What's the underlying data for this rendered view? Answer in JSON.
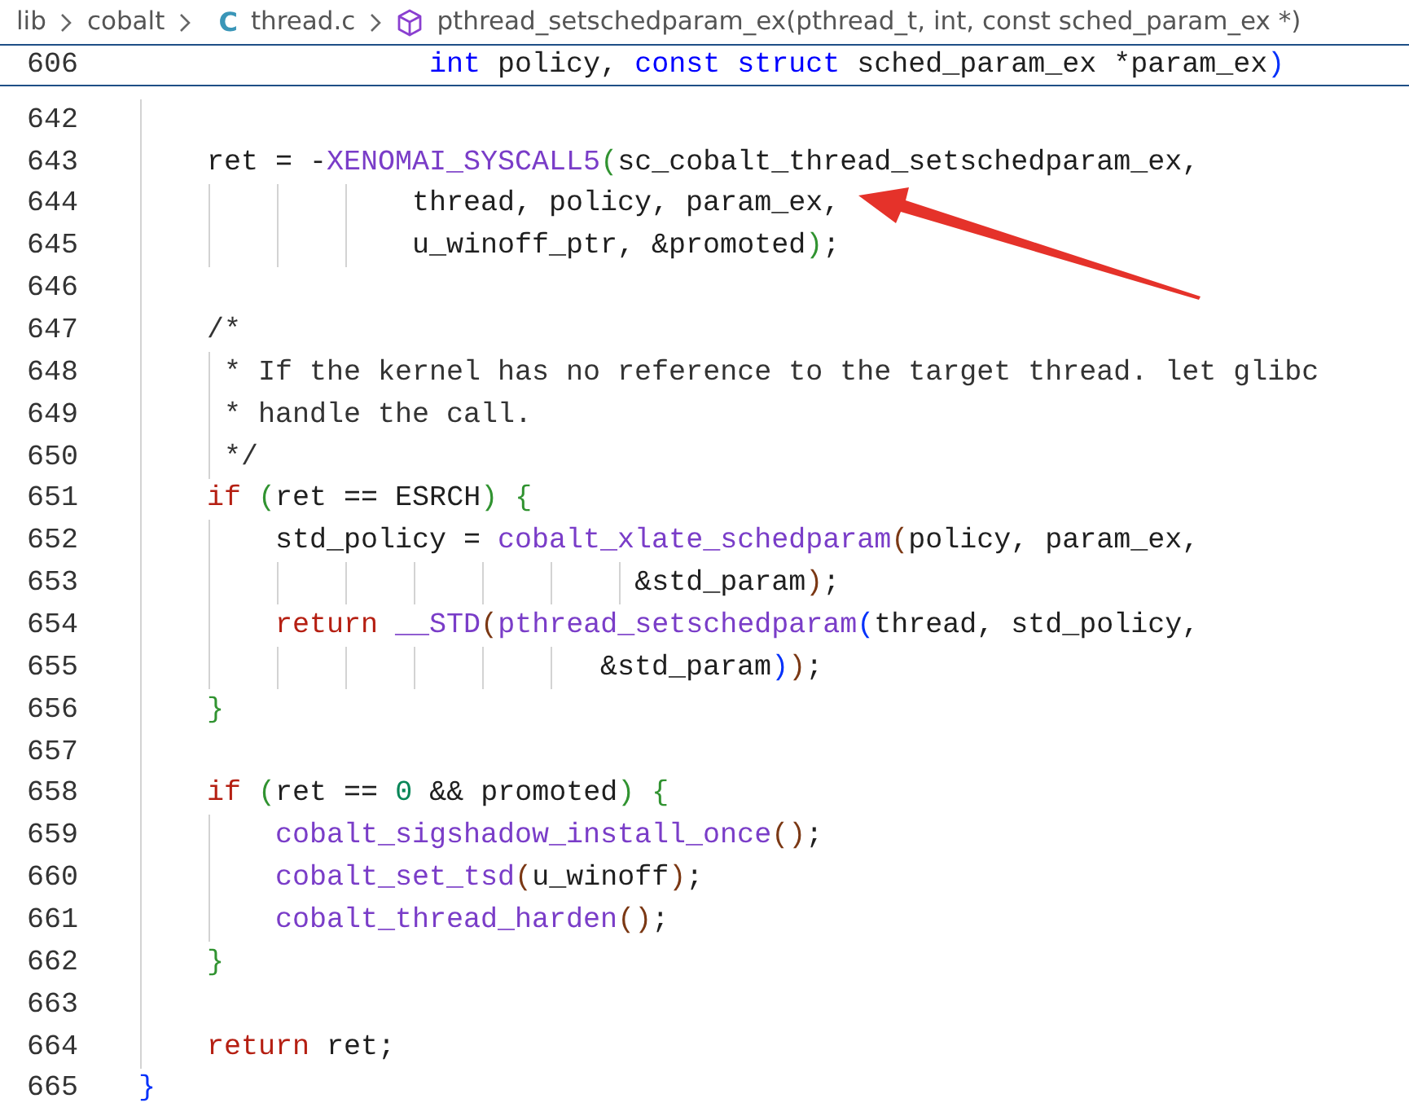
{
  "breadcrumb": [
    {
      "kind": "folder",
      "text": "lib"
    },
    {
      "kind": "folder",
      "text": "cobalt"
    },
    {
      "kind": "file",
      "icon": "C",
      "text": "thread.c"
    },
    {
      "kind": "symbol",
      "text": "pthread_setschedparam_ex(pthread_t, int, const sched_param_ex *)"
    }
  ],
  "sticky_line": {
    "number": "606",
    "tokens": [
      {
        "kind": "type",
        "text": "                 int"
      },
      {
        "kind": "txt",
        "text": " policy, "
      },
      {
        "kind": "type",
        "text": "const"
      },
      {
        "kind": "type",
        "text": " struct"
      },
      {
        "kind": "txt",
        "text": " sched_param_ex *param_ex"
      },
      {
        "kind": "br1",
        "text": ")"
      }
    ]
  },
  "lines": [
    {
      "number": "642"
    },
    {
      "number": "643",
      "tokens": [
        {
          "kind": "txt",
          "text": "    ret = -"
        },
        {
          "kind": "fn",
          "text": "XENOMAI_SYSCALL5"
        },
        {
          "kind": "br2",
          "text": "("
        },
        {
          "kind": "txt",
          "text": "sc_cobalt_thread_setschedparam_ex,"
        }
      ]
    },
    {
      "number": "644",
      "tokens": [
        {
          "kind": "txt",
          "text": "                thread, policy, param_ex,"
        }
      ]
    },
    {
      "number": "645",
      "tokens": [
        {
          "kind": "txt",
          "text": "                u_winoff_ptr, &promoted"
        },
        {
          "kind": "br2",
          "text": ")"
        },
        {
          "kind": "txt",
          "text": ";"
        }
      ]
    },
    {
      "number": "646"
    },
    {
      "number": "647",
      "tokens": [
        {
          "kind": "cmt",
          "text": "    /*"
        }
      ]
    },
    {
      "number": "648",
      "tokens": [
        {
          "kind": "cmt",
          "text": "     * If the kernel has no reference to the target thread. let glibc"
        }
      ]
    },
    {
      "number": "649",
      "tokens": [
        {
          "kind": "cmt",
          "text": "     * handle the call."
        }
      ]
    },
    {
      "number": "650",
      "tokens": [
        {
          "kind": "cmt",
          "text": "     */"
        }
      ]
    },
    {
      "number": "651",
      "tokens": [
        {
          "kind": "kw",
          "text": "    if"
        },
        {
          "kind": "br2",
          "text": " ("
        },
        {
          "kind": "txt",
          "text": "ret == ESRCH"
        },
        {
          "kind": "br2",
          "text": ")"
        },
        {
          "kind": "br2",
          "text": " {"
        }
      ]
    },
    {
      "number": "652",
      "tokens": [
        {
          "kind": "txt",
          "text": "        std_policy = "
        },
        {
          "kind": "fn",
          "text": "cobalt_xlate_schedparam"
        },
        {
          "kind": "br3",
          "text": "("
        },
        {
          "kind": "txt",
          "text": "policy, param_ex,"
        }
      ]
    },
    {
      "number": "653",
      "tokens": [
        {
          "kind": "txt",
          "text": "                             &std_param"
        },
        {
          "kind": "br3",
          "text": ")"
        },
        {
          "kind": "txt",
          "text": ";"
        }
      ]
    },
    {
      "number": "654",
      "tokens": [
        {
          "kind": "kw",
          "text": "        return"
        },
        {
          "kind": "fn",
          "text": " __STD"
        },
        {
          "kind": "br3",
          "text": "("
        },
        {
          "kind": "fn",
          "text": "pthread_setschedparam"
        },
        {
          "kind": "br1",
          "text": "("
        },
        {
          "kind": "txt",
          "text": "thread, std_policy,"
        }
      ]
    },
    {
      "number": "655",
      "tokens": [
        {
          "kind": "txt",
          "text": "                           &std_param"
        },
        {
          "kind": "br1",
          "text": ")"
        },
        {
          "kind": "br3",
          "text": ")"
        },
        {
          "kind": "txt",
          "text": ";"
        }
      ]
    },
    {
      "number": "656",
      "tokens": [
        {
          "kind": "br2",
          "text": "    }"
        }
      ]
    },
    {
      "number": "657"
    },
    {
      "number": "658",
      "tokens": [
        {
          "kind": "kw",
          "text": "    if"
        },
        {
          "kind": "br2",
          "text": " ("
        },
        {
          "kind": "txt",
          "text": "ret == "
        },
        {
          "kind": "num",
          "text": "0"
        },
        {
          "kind": "txt",
          "text": " && promoted"
        },
        {
          "kind": "br2",
          "text": ")"
        },
        {
          "kind": "br2",
          "text": " {"
        }
      ]
    },
    {
      "number": "659",
      "tokens": [
        {
          "kind": "fn",
          "text": "        cobalt_sigshadow_install_once"
        },
        {
          "kind": "br3",
          "text": "()"
        },
        {
          "kind": "txt",
          "text": ";"
        }
      ]
    },
    {
      "number": "660",
      "tokens": [
        {
          "kind": "fn",
          "text": "        cobalt_set_tsd"
        },
        {
          "kind": "br3",
          "text": "("
        },
        {
          "kind": "txt",
          "text": "u_winoff"
        },
        {
          "kind": "br3",
          "text": ")"
        },
        {
          "kind": "txt",
          "text": ";"
        }
      ]
    },
    {
      "number": "661",
      "tokens": [
        {
          "kind": "fn",
          "text": "        cobalt_thread_harden"
        },
        {
          "kind": "br3",
          "text": "()"
        },
        {
          "kind": "txt",
          "text": ";"
        }
      ]
    },
    {
      "number": "662",
      "tokens": [
        {
          "kind": "br2",
          "text": "    }"
        }
      ]
    },
    {
      "number": "663"
    },
    {
      "number": "664",
      "tokens": [
        {
          "kind": "kw",
          "text": "    return"
        },
        {
          "kind": "txt",
          "text": " ret;"
        }
      ]
    },
    {
      "number": "665",
      "tokens": [
        {
          "kind": "br1",
          "text": "}"
        }
      ]
    }
  ]
}
